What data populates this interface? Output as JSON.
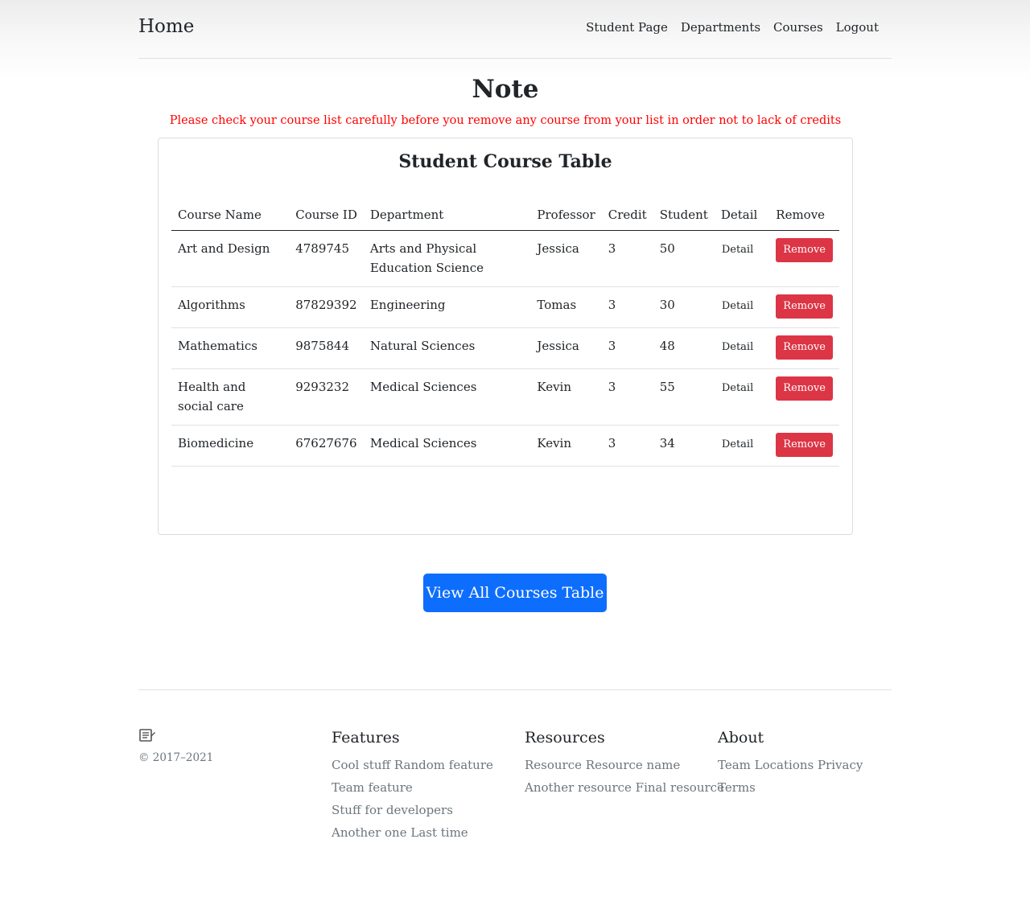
{
  "nav": {
    "brand": "Home",
    "links": [
      "Student Page",
      "Departments",
      "Courses",
      "Logout"
    ]
  },
  "note": {
    "title": "Note",
    "text": "Please check your course list carefully before you remove any course from your list in order not to lack of credits"
  },
  "table": {
    "title": "Student Course Table",
    "headers": [
      "Course Name",
      "Course ID",
      "Department",
      "Professor",
      "Credit",
      "Student",
      "Detail",
      "Remove"
    ],
    "rows": [
      {
        "name": "Art and Design",
        "id": "4789745",
        "department": "Arts and Physical Education Science",
        "professor": "Jessica",
        "credit": "3",
        "student": "50",
        "detail": "Detail",
        "remove": "Remove"
      },
      {
        "name": "Algorithms",
        "id": "87829392",
        "department": "Engineering",
        "professor": "Tomas",
        "credit": "3",
        "student": "30",
        "detail": "Detail",
        "remove": "Remove"
      },
      {
        "name": "Mathematics",
        "id": "9875844",
        "department": "Natural Sciences",
        "professor": "Jessica",
        "credit": "3",
        "student": "48",
        "detail": "Detail",
        "remove": "Remove"
      },
      {
        "name": "Health and social care",
        "id": "9293232",
        "department": "Medical Sciences",
        "professor": "Kevin",
        "credit": "3",
        "student": "55",
        "detail": "Detail",
        "remove": "Remove"
      },
      {
        "name": "Biomedicine",
        "id": "67627676",
        "department": "Medical Sciences",
        "professor": "Kevin",
        "credit": "3",
        "student": "34",
        "detail": "Detail",
        "remove": "Remove"
      }
    ]
  },
  "view_all_button": "View All Courses Table",
  "footer": {
    "logo_icon": "notebook-icon",
    "copyright": "© 2017–2021",
    "columns": [
      {
        "title": "Features",
        "links": [
          "Cool stuff Random feature",
          "Team feature",
          "Stuff for developers",
          "Another one Last time"
        ]
      },
      {
        "title": "Resources",
        "links": [
          "Resource Resource name",
          "Another resource Final resource"
        ]
      },
      {
        "title": "About",
        "links": [
          "Team Locations Privacy Terms"
        ]
      }
    ]
  },
  "colors": {
    "primary": "#0d6efd",
    "danger": "#dc3545",
    "note_red": "#ff0000",
    "muted": "#6c757d"
  }
}
